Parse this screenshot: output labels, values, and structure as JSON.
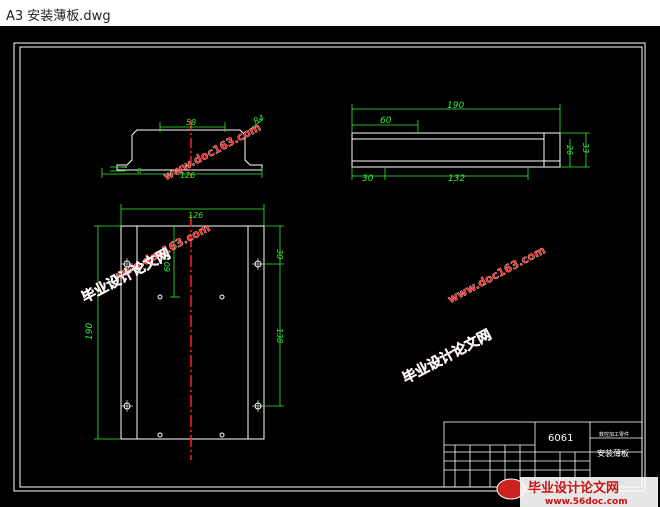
{
  "window": {
    "title": "A3 安装薄板.dwg"
  },
  "colors": {
    "background": "#000000",
    "outline": "#ffffff",
    "dimension": "#33ee33",
    "centerline": "#ff2222",
    "watermark": "#ff1a1a"
  },
  "top_view": {
    "dim_width": "58",
    "dim_radius": "R4",
    "dim_total": "126",
    "dim_thickness": "6"
  },
  "front_view": {
    "dim_hole_y": "60",
    "dim_height": "190",
    "dim_top": "30",
    "dim_mid": "138",
    "dim_width": "126"
  },
  "side_view": {
    "dim_length": "190",
    "dim_hole": "60",
    "dim_start": "30",
    "dim_span": "132",
    "dim_inner_h": "26",
    "dim_outer_h": "33"
  },
  "title_block": {
    "material": "6061",
    "company": "数控加工零件",
    "part_name": "安装薄板"
  },
  "watermarks": {
    "url": "www.doc163.com",
    "site_cn": "毕业设计论文网",
    "logo_text": "毕业设计论文网",
    "logo_url": "www.56doc.com"
  }
}
